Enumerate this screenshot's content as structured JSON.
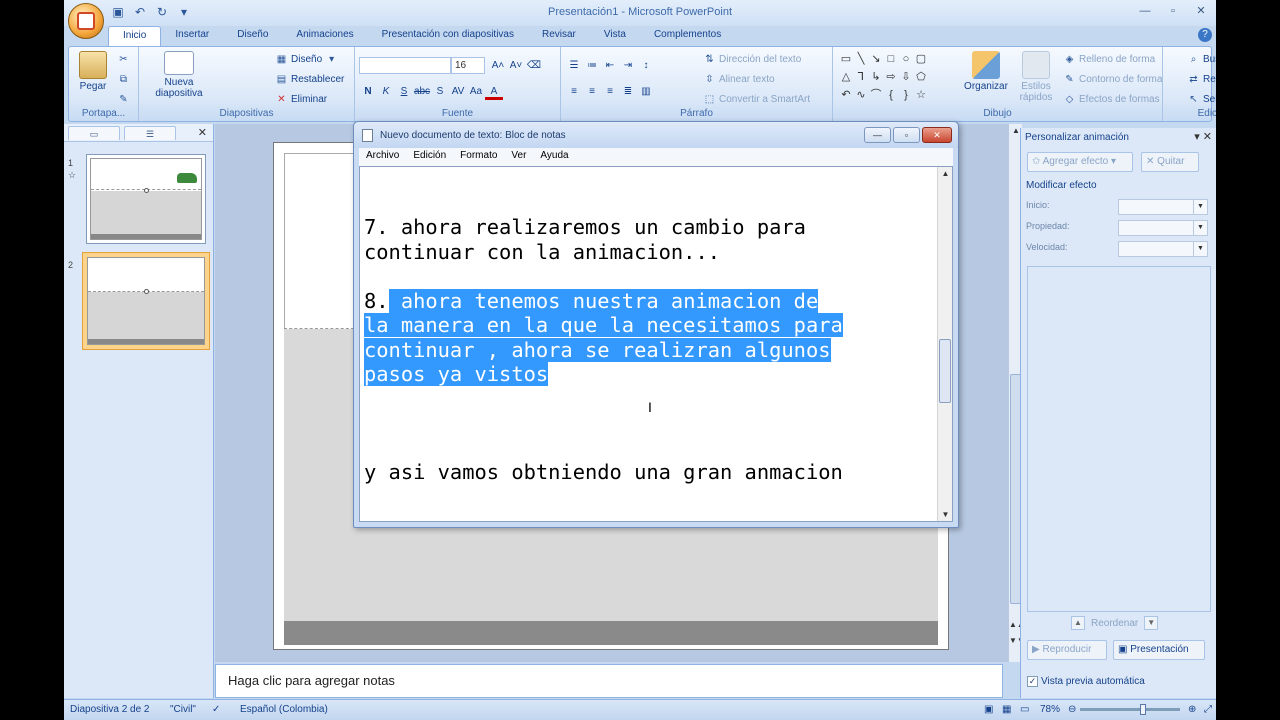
{
  "app": {
    "window_title": "Presentación1 - Microsoft PowerPoint"
  },
  "tabs": [
    "Inicio",
    "Insertar",
    "Diseño",
    "Animaciones",
    "Presentación con diapositivas",
    "Revisar",
    "Vista",
    "Complementos"
  ],
  "ribbon": {
    "portapapeles": {
      "pegar": "Pegar",
      "label": "Portapa..."
    },
    "diapositivas": {
      "nueva_1": "Nueva",
      "nueva_2": "diapositiva",
      "diseno": "Diseño",
      "restablecer": "Restablecer",
      "eliminar": "Eliminar",
      "label": "Diapositivas"
    },
    "fuente": {
      "font_name": "",
      "font_size": "16",
      "label": "Fuente"
    },
    "parrafo": {
      "direccion": "Dirección del texto",
      "alinear": "Alinear texto",
      "smartart": "Convertir a SmartArt",
      "label": "Párrafo"
    },
    "dibujo": {
      "organizar": "Organizar",
      "estilos_1": "Estilos",
      "estilos_2": "rápidos",
      "relleno": "Relleno de forma",
      "contorno": "Contorno de forma",
      "efectos": "Efectos de formas",
      "label": "Dibujo"
    },
    "edicion": {
      "buscar": "Buscar",
      "reemplazar": "Reemplazar",
      "seleccionar": "Seleccionar",
      "label": "Edición"
    }
  },
  "slides": [
    {
      "number": "1"
    },
    {
      "number": "2"
    }
  ],
  "notes_placeholder": "Haga clic para agregar notas",
  "animation_pane": {
    "title": "Personalizar animación",
    "add_effect": "Agregar efecto",
    "remove": "Quitar",
    "modify_heading": "Modificar efecto",
    "inicio": "Inicio:",
    "propiedad": "Propiedad:",
    "velocidad": "Velocidad:",
    "reordenar": "Reordenar",
    "reproducir": "Reproducir",
    "presentacion": "Presentación",
    "vista_previa": "Vista previa automática"
  },
  "status": {
    "slide": "Diapositiva 2 de 2",
    "theme": "\"Civil\"",
    "language": "Español (Colombia)",
    "zoom": "78%"
  },
  "notepad": {
    "title": "Nuevo documento de texto: Bloc de notas",
    "menu": [
      "Archivo",
      "Edición",
      "Formato",
      "Ver",
      "Ayuda"
    ],
    "lines": [
      {
        "plain": "7. ahora realizaremos un cambio para",
        "sel": ""
      },
      {
        "plain": "continuar con la animacion...",
        "sel": ""
      },
      {
        "plain": "",
        "sel": ""
      },
      {
        "plain": "8.",
        "sel": " ahora tenemos nuestra animacion de"
      },
      {
        "plain": "",
        "sel": "la manera en la que la necesitamos para"
      },
      {
        "plain": "",
        "sel": "continuar , ahora se realizran algunos"
      },
      {
        "plain": "",
        "sel": "pasos ya vistos"
      },
      {
        "plain": "",
        "sel": ""
      },
      {
        "plain": "",
        "sel": ""
      },
      {
        "plain": "",
        "sel": ""
      },
      {
        "plain": "y asi vamos obtniendo una gran anmacion",
        "sel": ""
      }
    ]
  }
}
